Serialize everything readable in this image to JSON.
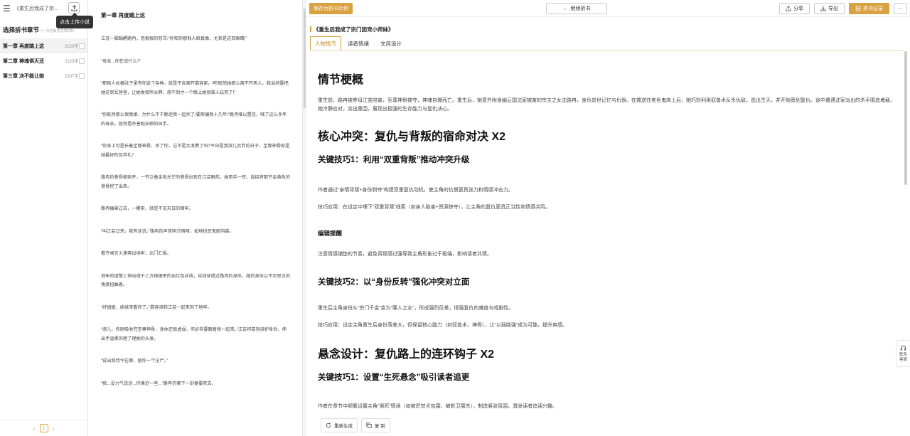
{
  "sidebar": {
    "book_title": "《重生后我成了宗...",
    "tooltip": "点击上传小说",
    "heading": "选择拆书章节",
    "subheading": "(一次性最多选择5章)",
    "chapters": [
      {
        "name": "第一章 再度踏上这",
        "words": "2120字"
      },
      {
        "name": "第二章 神魂俱灭还",
        "words": "2123字"
      },
      {
        "name": "第三章 决不能让她",
        "words": "2107字"
      }
    ],
    "page": "1"
  },
  "reader": {
    "chapter_title": "第一章 再度踏上这",
    "paragraphs": [
      "江芸一脚踹醒路冉，恶狠狠的怒骂:“你和你那贱人娘真像，尤其是这双眼睛!”",
      "“母亲...你在说什么?”",
      "“那贱人仗着肚子里有你这个杂种，就是不肯离开慕容家。呵!既然她那么离不开男人，我当然要把她送到军营里，让她发挥所长啊，想不到才一个晚上她就被人玩死了!”",
      "“你既然那么恨我娘，为什么不干脆连我一起杀了!要欺骗我十几年!”路冉难以置信，喊了这么多年的母亲，居然是杀害她亲娘的凶手。",
      "“你身上可是长着至尊神骨，杀了你，岂不是太浪费了吗?今日是我淑儿及笄的日子，至尊神骨就是她最好的及笄礼!”",
      "路冉的脊骨被剜开，一节泛着金色光芒的脊骨出现在江芸眼前，她用手一挥，直接将那节金黄色的脊骨挖了出来。",
      "路冉痛晕过去，一醒来，就是不见天日的暗牢。",
      "“叫江芸过来，我有话说。”路冉的声音阴冷暗哑，如地狱恶鬼般阴森。",
      "看守闻言火速奔出地牢，出门汇报。",
      "地牢的墙壁上伸出成千上万根细密的血红色丝线，丝线穿透过路冉的身体，她的身体以不可思议的角度扭曲着。",
      "“好姐姐，妹妹来看你了。”慕容淑和江芸一起来到了地牢。",
      "“淑儿，你刚吸收完至尊神骨，身体还很虚弱，何必非要跟着我一起来。”江芸将慕容淑护身后，伸出手温柔的理了理她的头发。",
      "“说出叔侍今在哪，留你一个全尸。”",
      "“我...没力气说话...你凑近一些...”路冉仿佛下一刻便要死去。"
    ]
  },
  "toolbar": {
    "save_label": "保存为拆书示例",
    "continue_label": "继续拆书",
    "share_label": "分享",
    "export_label": "导出",
    "record_label": "拆书记录"
  },
  "analysis": {
    "book_title": "《重生后我成了宗门团宠小师妹》",
    "tabs": [
      "人物情节",
      "读者情绪",
      "文风设计"
    ],
    "summary_title": "情节梗概",
    "summary_text": "重生前，路冉被养母江芸陷害，至尊神骨被夺，神魂自爆而亡。重生后，她意外附身幽云国沈家被废的宗主之女沈路冉，身负前世记忆与仇恨。在被送往老色鬼床上后，她巧妙利用驭兽术反杀仇敌，逃出生天，并开始策划复仇。途中遭遇沈家派出的杀手围追堵截，她冷静应对，突出重围，展现出极强的生存能力与复仇决心。",
    "section1_title": "核心冲突：复仇与背叛的宿命对决 X2",
    "skill1_title": "关键技巧1：利用“双重背叛”推动冲突升级",
    "skill1_text1": "作者通过“亲情背叛+身份剥夺”构建双重复仇动机，使主角的仇恨更具张力和情感冲击力。",
    "skill1_text2": "技巧应用：在设定中埋下“双重背叛”线索（如亲人陷害+资源掠夺），让主角的复仇更具正当性和情感共鸣。",
    "note_title": "编辑提醒",
    "note_text": "注意情感铺垫的节奏，避免背叛感过强导致主角形象过于极端，影响读者共情。",
    "skill2_title": "关键技巧2：以“身份反转”强化冲突对立面",
    "skill2_text1": "重生后主角身份从“宗门千金”变为“罪人之女”，形成强烈反差，增强复仇的难度与戏剧性。",
    "skill2_text2": "技巧应用：设定主角重生后身份落差大，但保留核心能力（如驭兽术、神骨），让“以弱胜强”成为可能，提升爽感。",
    "section2_title": "悬念设计：复仇路上的连环钩子 X2",
    "skill3_title": "关键技巧1：设置“生死悬念”吸引读者追更",
    "skill3_text1": "作者在章节中频繁设置主角“濒死”情境（如被炽焚犬包围、被影卫围杀），制造紧张氛围，激发读者追读兴趣。",
    "regen_label": "重新生成",
    "copy_label": "复 制",
    "contact_label": "联系客服"
  }
}
